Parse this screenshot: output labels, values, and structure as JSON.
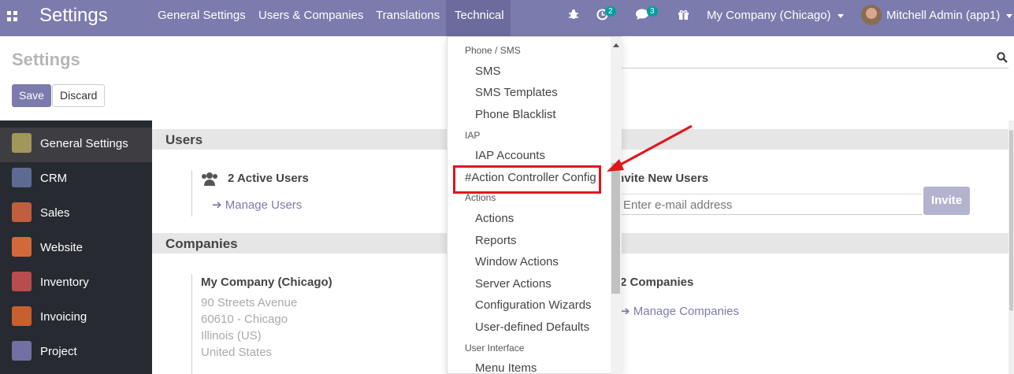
{
  "topbar": {
    "brand": "Settings",
    "menus": [
      "General Settings",
      "Users & Companies",
      "Translations",
      "Technical"
    ],
    "activity_count": "2",
    "messages_count": "3",
    "company": "My Company (Chicago)",
    "user": "Mitchell Admin (app1)"
  },
  "control_panel": {
    "title": "Settings",
    "save_label": "Save",
    "discard_label": "Discard"
  },
  "sidebar": {
    "items": [
      {
        "label": "General Settings",
        "icon": "gear-icon",
        "color": "#a2975b"
      },
      {
        "label": "CRM",
        "icon": "handshake-icon",
        "color": "#5d6b93"
      },
      {
        "label": "Sales",
        "icon": "chart-icon",
        "color": "#c05f3d"
      },
      {
        "label": "Website",
        "icon": "globe-icon",
        "color": "#d2693b"
      },
      {
        "label": "Inventory",
        "icon": "box-icon",
        "color": "#b84d4d"
      },
      {
        "label": "Invoicing",
        "icon": "dollar-icon",
        "color": "#c6602e"
      },
      {
        "label": "Project",
        "icon": "puzzle-icon",
        "color": "#7270a3"
      }
    ]
  },
  "main": {
    "users_header": "Users",
    "active_users": "2 Active Users",
    "manage_users": "Manage Users",
    "invite_title": "Invite New Users",
    "email_placeholder": "Enter e-mail address",
    "invite_label": "Invite",
    "companies_header": "Companies",
    "company_name": "My Company (Chicago)",
    "address": [
      "90 Streets Avenue",
      "60610 - Chicago",
      "Illinois (US)",
      "United States"
    ],
    "companies_count": "2 Companies",
    "manage_companies": "Manage Companies"
  },
  "dropdown": {
    "entries": [
      {
        "type": "header",
        "label": "Phone / SMS"
      },
      {
        "type": "item",
        "label": "SMS"
      },
      {
        "type": "item",
        "label": "SMS Templates"
      },
      {
        "type": "item",
        "label": "Phone Blacklist"
      },
      {
        "type": "header",
        "label": "IAP"
      },
      {
        "type": "item",
        "label": "IAP Accounts"
      },
      {
        "type": "header",
        "label": "#Action Controller Config"
      },
      {
        "type": "header",
        "label": "Actions"
      },
      {
        "type": "item",
        "label": "Actions"
      },
      {
        "type": "item",
        "label": "Reports"
      },
      {
        "type": "item",
        "label": "Window Actions"
      },
      {
        "type": "item",
        "label": "Server Actions"
      },
      {
        "type": "item",
        "label": "Configuration Wizards"
      },
      {
        "type": "item",
        "label": "User-defined Defaults"
      },
      {
        "type": "header",
        "label": "User Interface"
      },
      {
        "type": "item",
        "label": "Menu Items"
      }
    ]
  },
  "colors": {
    "brand": "#7c7bad",
    "annotation": "#e0161b"
  }
}
